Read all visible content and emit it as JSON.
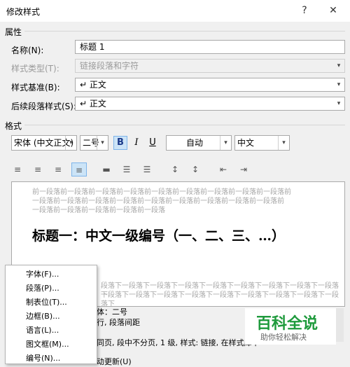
{
  "window": {
    "title": "修改样式",
    "help": "?",
    "close": "✕"
  },
  "properties": {
    "section": "属性",
    "name_label": "名称(N):",
    "name_value": "标题 1",
    "type_label": "样式类型(T):",
    "type_value": "链接段落和字符",
    "base_label": "样式基准(B):",
    "base_value": "↵ 正文",
    "next_label": "后续段落样式(S):",
    "next_value": "↵ 正文"
  },
  "format": {
    "section": "格式",
    "font": "宋体 (中文正文)",
    "size": "二号",
    "bold": "B",
    "italic": "I",
    "underline": "U",
    "color": "自动",
    "language": "中文"
  },
  "preview": {
    "prev_lines": [
      "前一段落前一段落前一段落前一段落前一段落前一段落前一段落前一段落前一段落前",
      "一段落前一段落前一段落前一段落前一段落前一段落前一段落前一段落前一段落前",
      "一段落前一段落前一段落前一段落前一段落"
    ],
    "heading": "标题一：中文一级编号（一、二、三、…）",
    "next_lines": [
      "段落下一段落下一段落下一段落下一段落下一段落下一段落下一段落下一段落下",
      "一段落下一段落下一段落下一段落下一段落下一段落下一段落下一段落下一段落下"
    ]
  },
  "description": {
    "line1": "体：二号",
    "line2": "行, 段落间距",
    "line3": "同页, 段中不分页, 1 级, 样式: 链接, 在样式库中",
    "line4": "动更新(U)"
  },
  "context_menu": [
    "字体(F)...",
    "段落(P)...",
    "制表位(T)...",
    "边框(B)...",
    "语言(L)...",
    "图文框(M)...",
    "编号(N)..."
  ],
  "watermark": {
    "brand": "百科全说",
    "slogan": "助你轻松解决"
  }
}
